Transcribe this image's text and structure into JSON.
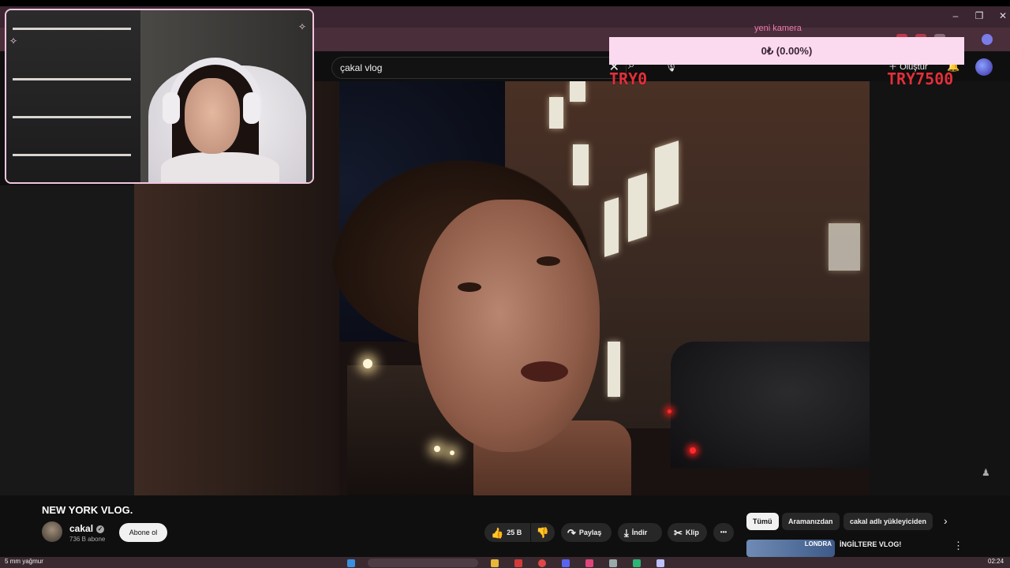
{
  "browser": {
    "minimize_icon": "–",
    "restore_icon": "❐",
    "close_icon": "✕"
  },
  "youtube": {
    "search_query": "çakal vlog",
    "clear_icon": "✕",
    "search_icon": "⌕",
    "mic_icon": "🎙",
    "create_label": "Oluştur",
    "bell_icon": "🔔"
  },
  "overlay": {
    "donation_label": "yeni kamera",
    "donation_amount": "0₺ (0.00%)",
    "goal_current": "TRY0",
    "goal_target": "TRY7500",
    "sparkle": "✧"
  },
  "video": {
    "title": "NEW YORK VLOG.",
    "channel_name": "cakal",
    "verified_icon": "✓",
    "subscribers": "736 B abone",
    "subscribe_label": "Abone ol",
    "like_count": "25 B",
    "like_icon": "👍",
    "dislike_icon": "👎",
    "share_label": "Paylaş",
    "share_icon": "↷",
    "download_label": "İndir",
    "download_icon": "⤓",
    "clip_label": "Klip",
    "clip_icon": "✂",
    "more_icon": "•••"
  },
  "recommendations": {
    "chips": [
      "Tümü",
      "Aramanızdan",
      "cakal adlı yükleyiciden"
    ],
    "next_icon": "›",
    "items": [
      {
        "thumb_text": "LONDRA",
        "title": "İNGİLTERE VLOG!"
      }
    ],
    "more_icon": "⋮"
  },
  "taskbar": {
    "weather": "5 mm yağmur",
    "time": "02:24"
  },
  "colors": {
    "accent_pink": "#fbd9ef",
    "goal_red": "#e0303a",
    "yt_bg": "#0f0f0f"
  }
}
